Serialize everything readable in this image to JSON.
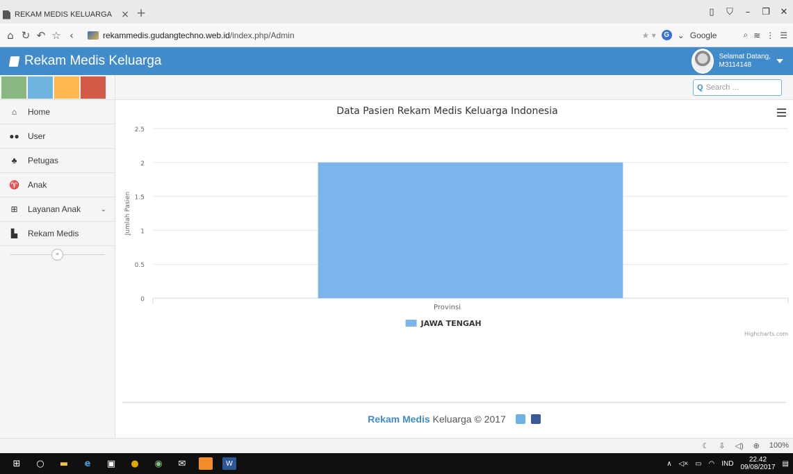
{
  "browser": {
    "tab_title": "REKAM MEDIS KELUARGA",
    "tab_close": "×",
    "new_tab": "+",
    "url_domain": "rekammedis.gudangtechno.web.id",
    "url_path": "/index.php/Admin",
    "search_engine": "Google",
    "zoom": "100%"
  },
  "app": {
    "brand": "Rekam Medis Keluarga",
    "greeting": "Selamat Datang,",
    "username": "M3114148",
    "search_placeholder": "Search ..."
  },
  "sidebar": {
    "shortcut_colors": [
      "#87b87f",
      "#6fb3e0",
      "#ffb752",
      "#d15b47"
    ],
    "items": [
      {
        "label": "Home",
        "icon": "home-icon"
      },
      {
        "label": "User",
        "icon": "users-icon"
      },
      {
        "label": "Petugas",
        "icon": "staff-icon"
      },
      {
        "label": "Anak",
        "icon": "child-icon"
      },
      {
        "label": "Layanan Anak",
        "icon": "service-icon"
      },
      {
        "label": "Rekam Medis",
        "icon": "records-icon"
      }
    ]
  },
  "chart_data": {
    "type": "bar",
    "title": "Data Pasien Rekam Medis Keluarga Indonesia",
    "xlabel": "Provinsi",
    "ylabel": "Jumlah Pasien",
    "ylim": [
      0,
      2.5
    ],
    "yticks": [
      "0",
      "0.5",
      "1",
      "1.5",
      "2",
      "2.5"
    ],
    "categories": [
      "Provinsi"
    ],
    "series": [
      {
        "name": "JAWA TENGAH",
        "values": [
          2
        ],
        "color": "#7cb5ec"
      }
    ],
    "legend": "bottom-center",
    "grid": true,
    "credits": "Highcharts.com"
  },
  "footer": {
    "brand_bold": "Rekam Medis",
    "rest": " Keluarga © 2017"
  },
  "taskbar": {
    "lang": "IND",
    "time": "22.42",
    "date": "09/08/2017"
  }
}
